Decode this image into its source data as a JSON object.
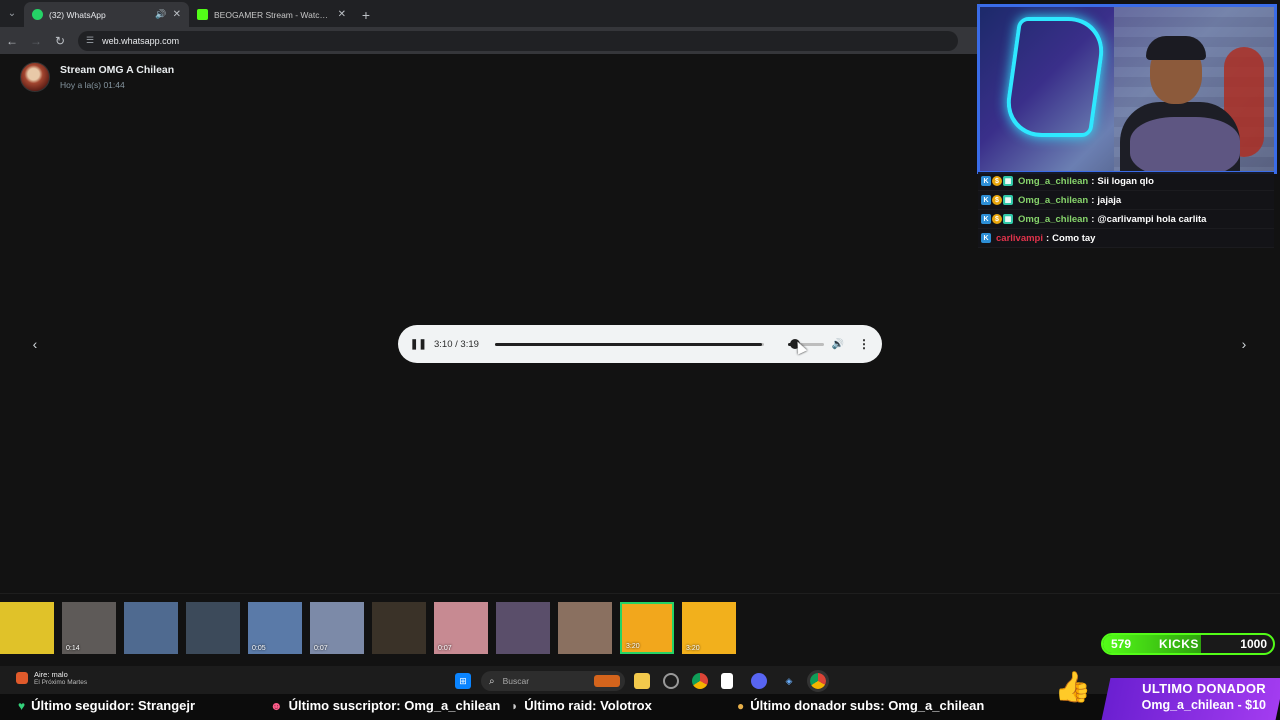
{
  "browser": {
    "tabs": [
      {
        "title": "(32) WhatsApp",
        "favicon_color": "#25d366",
        "active": true
      },
      {
        "title": "BEOGAMER Stream - Watch Li...",
        "favicon_color": "#53fc18",
        "active": false
      }
    ],
    "url": "web.whatsapp.com"
  },
  "viewer": {
    "sender_name": "Stream OMG A Chilean",
    "sent_time": "Hoy a la(s) 01:44"
  },
  "player": {
    "time": "3:10 / 3:19",
    "progress": 0.993,
    "volume": 0.2
  },
  "chat": [
    {
      "user": "Omg_a_chilean",
      "color": "#86d36b",
      "message": "Sii logan qlo",
      "badges": 3
    },
    {
      "user": "Omg_a_chilean",
      "color": "#86d36b",
      "message": "jajaja",
      "badges": 3
    },
    {
      "user": "Omg_a_chilean",
      "color": "#86d36b",
      "message": "@carlivampi hola carlita",
      "badges": 3
    },
    {
      "user": "carlivampi",
      "color": "#e0334b",
      "message": "Como tay",
      "badges": 1
    }
  ],
  "thumbnails": [
    {
      "dur": "",
      "color": "#e0c229"
    },
    {
      "dur": "0:14",
      "color": "#5e5a58"
    },
    {
      "dur": "",
      "color": "#4f6a90"
    },
    {
      "dur": "",
      "color": "#3c4a5a"
    },
    {
      "dur": "0:05",
      "color": "#5a7aa8"
    },
    {
      "dur": "0:07",
      "color": "#7c8aa8"
    },
    {
      "dur": "",
      "color": "#3a3228"
    },
    {
      "dur": "0:07",
      "color": "#c78a92"
    },
    {
      "dur": "",
      "color": "#5a4e6a"
    },
    {
      "dur": "",
      "color": "#8a7060"
    },
    {
      "dur": "3:20",
      "color": "#f2a71c"
    },
    {
      "dur": "3:20",
      "color": "#f2b01c"
    }
  ],
  "kicks": {
    "current": "579",
    "label": "KICKS",
    "goal": "1000",
    "fraction": 0.579,
    "color": "#53fc18"
  },
  "taskbar": {
    "weather_line1": "Aire: malo",
    "weather_line2": "El Próximo Martes",
    "search_placeholder": "Buscar"
  },
  "ticker": {
    "follower": "Último seguidor: Strangejr",
    "subscriber": "Último suscriptor: Omg_a_chilean",
    "raid": "Último raid: Volotrox",
    "donor_subs": "Último donador subs: Omg_a_chilean"
  },
  "donor_panel": {
    "title": "ULTIMO DONADOR",
    "value": "Omg_a_chilean - $10"
  }
}
